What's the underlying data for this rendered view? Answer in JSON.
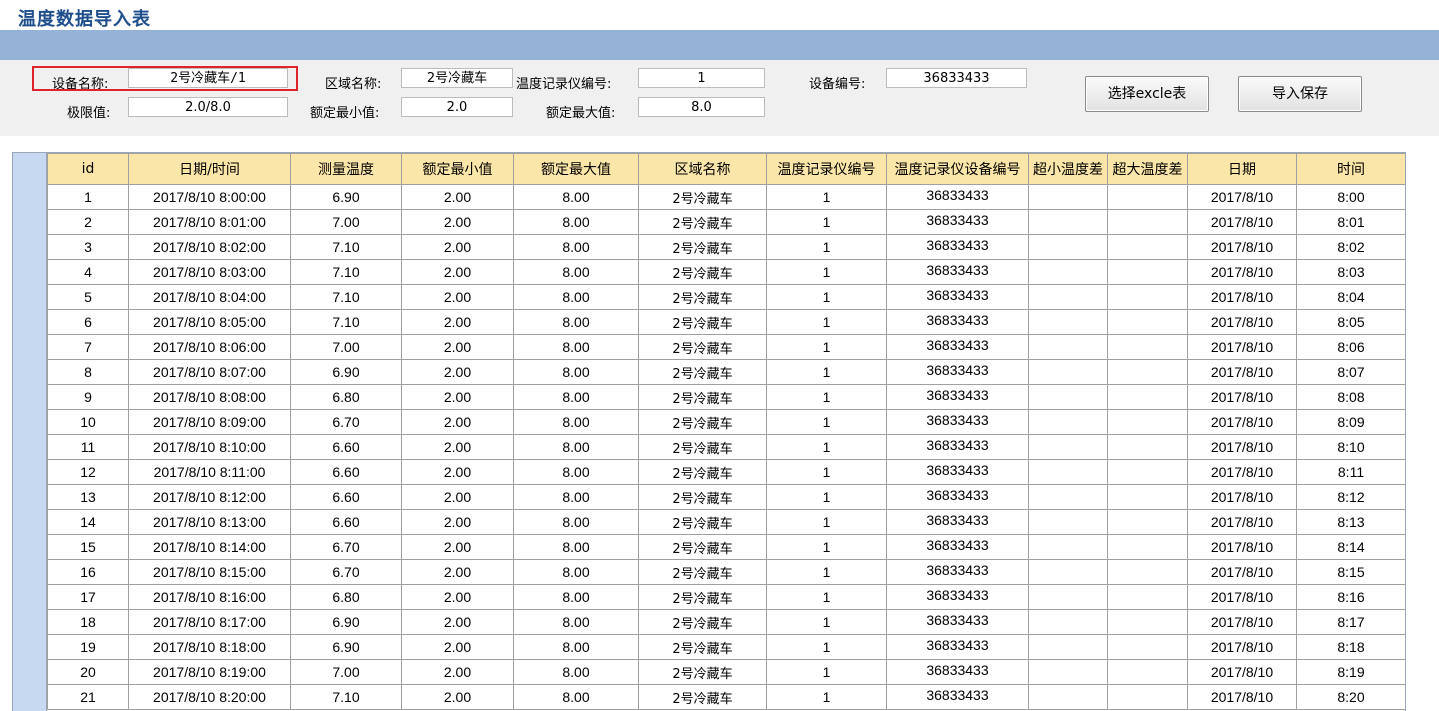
{
  "app": {
    "title": "温度数据导入表"
  },
  "form": {
    "device_name_label": "设备名称:",
    "device_name_value": "2号冷藏车/1",
    "area_name_label": "区域名称:",
    "area_name_value": "2号冷藏车",
    "recorder_no_label": "温度记录仪编号:",
    "recorder_no_value": "1",
    "device_no_label": "设备编号:",
    "device_no_value": "36833433",
    "limit_label": "极限值:",
    "limit_value": "2.0/8.0",
    "rated_min_label": "额定最小值:",
    "rated_min_value": "2.0",
    "rated_max_label": "额定最大值:",
    "rated_max_value": "8.0"
  },
  "buttons": {
    "select_excel": "选择excle表",
    "import_save": "导入保存"
  },
  "table": {
    "headers": [
      "id",
      "日期/时间",
      "测量温度",
      "额定最小值",
      "额定最大值",
      "区域名称",
      "温度记录仪编号",
      "温度记录仪设备编号",
      "超小温度差",
      "超大温度差",
      "日期",
      "时间"
    ],
    "rows": [
      [
        "1",
        "2017/8/10 8:00:00",
        "6.90",
        "2.00",
        "8.00",
        "2号冷藏车",
        "1",
        "36833433",
        "",
        "",
        "2017/8/10",
        "8:00"
      ],
      [
        "2",
        "2017/8/10 8:01:00",
        "7.00",
        "2.00",
        "8.00",
        "2号冷藏车",
        "1",
        "36833433",
        "",
        "",
        "2017/8/10",
        "8:01"
      ],
      [
        "3",
        "2017/8/10 8:02:00",
        "7.10",
        "2.00",
        "8.00",
        "2号冷藏车",
        "1",
        "36833433",
        "",
        "",
        "2017/8/10",
        "8:02"
      ],
      [
        "4",
        "2017/8/10 8:03:00",
        "7.10",
        "2.00",
        "8.00",
        "2号冷藏车",
        "1",
        "36833433",
        "",
        "",
        "2017/8/10",
        "8:03"
      ],
      [
        "5",
        "2017/8/10 8:04:00",
        "7.10",
        "2.00",
        "8.00",
        "2号冷藏车",
        "1",
        "36833433",
        "",
        "",
        "2017/8/10",
        "8:04"
      ],
      [
        "6",
        "2017/8/10 8:05:00",
        "7.10",
        "2.00",
        "8.00",
        "2号冷藏车",
        "1",
        "36833433",
        "",
        "",
        "2017/8/10",
        "8:05"
      ],
      [
        "7",
        "2017/8/10 8:06:00",
        "7.00",
        "2.00",
        "8.00",
        "2号冷藏车",
        "1",
        "36833433",
        "",
        "",
        "2017/8/10",
        "8:06"
      ],
      [
        "8",
        "2017/8/10 8:07:00",
        "6.90",
        "2.00",
        "8.00",
        "2号冷藏车",
        "1",
        "36833433",
        "",
        "",
        "2017/8/10",
        "8:07"
      ],
      [
        "9",
        "2017/8/10 8:08:00",
        "6.80",
        "2.00",
        "8.00",
        "2号冷藏车",
        "1",
        "36833433",
        "",
        "",
        "2017/8/10",
        "8:08"
      ],
      [
        "10",
        "2017/8/10 8:09:00",
        "6.70",
        "2.00",
        "8.00",
        "2号冷藏车",
        "1",
        "36833433",
        "",
        "",
        "2017/8/10",
        "8:09"
      ],
      [
        "11",
        "2017/8/10 8:10:00",
        "6.60",
        "2.00",
        "8.00",
        "2号冷藏车",
        "1",
        "36833433",
        "",
        "",
        "2017/8/10",
        "8:10"
      ],
      [
        "12",
        "2017/8/10 8:11:00",
        "6.60",
        "2.00",
        "8.00",
        "2号冷藏车",
        "1",
        "36833433",
        "",
        "",
        "2017/8/10",
        "8:11"
      ],
      [
        "13",
        "2017/8/10 8:12:00",
        "6.60",
        "2.00",
        "8.00",
        "2号冷藏车",
        "1",
        "36833433",
        "",
        "",
        "2017/8/10",
        "8:12"
      ],
      [
        "14",
        "2017/8/10 8:13:00",
        "6.60",
        "2.00",
        "8.00",
        "2号冷藏车",
        "1",
        "36833433",
        "",
        "",
        "2017/8/10",
        "8:13"
      ],
      [
        "15",
        "2017/8/10 8:14:00",
        "6.70",
        "2.00",
        "8.00",
        "2号冷藏车",
        "1",
        "36833433",
        "",
        "",
        "2017/8/10",
        "8:14"
      ],
      [
        "16",
        "2017/8/10 8:15:00",
        "6.70",
        "2.00",
        "8.00",
        "2号冷藏车",
        "1",
        "36833433",
        "",
        "",
        "2017/8/10",
        "8:15"
      ],
      [
        "17",
        "2017/8/10 8:16:00",
        "6.80",
        "2.00",
        "8.00",
        "2号冷藏车",
        "1",
        "36833433",
        "",
        "",
        "2017/8/10",
        "8:16"
      ],
      [
        "18",
        "2017/8/10 8:17:00",
        "6.90",
        "2.00",
        "8.00",
        "2号冷藏车",
        "1",
        "36833433",
        "",
        "",
        "2017/8/10",
        "8:17"
      ],
      [
        "19",
        "2017/8/10 8:18:00",
        "6.90",
        "2.00",
        "8.00",
        "2号冷藏车",
        "1",
        "36833433",
        "",
        "",
        "2017/8/10",
        "8:18"
      ],
      [
        "20",
        "2017/8/10 8:19:00",
        "7.00",
        "2.00",
        "8.00",
        "2号冷藏车",
        "1",
        "36833433",
        "",
        "",
        "2017/8/10",
        "8:19"
      ],
      [
        "21",
        "2017/8/10 8:20:00",
        "7.10",
        "2.00",
        "8.00",
        "2号冷藏车",
        "1",
        "36833433",
        "",
        "",
        "2017/8/10",
        "8:20"
      ]
    ]
  }
}
